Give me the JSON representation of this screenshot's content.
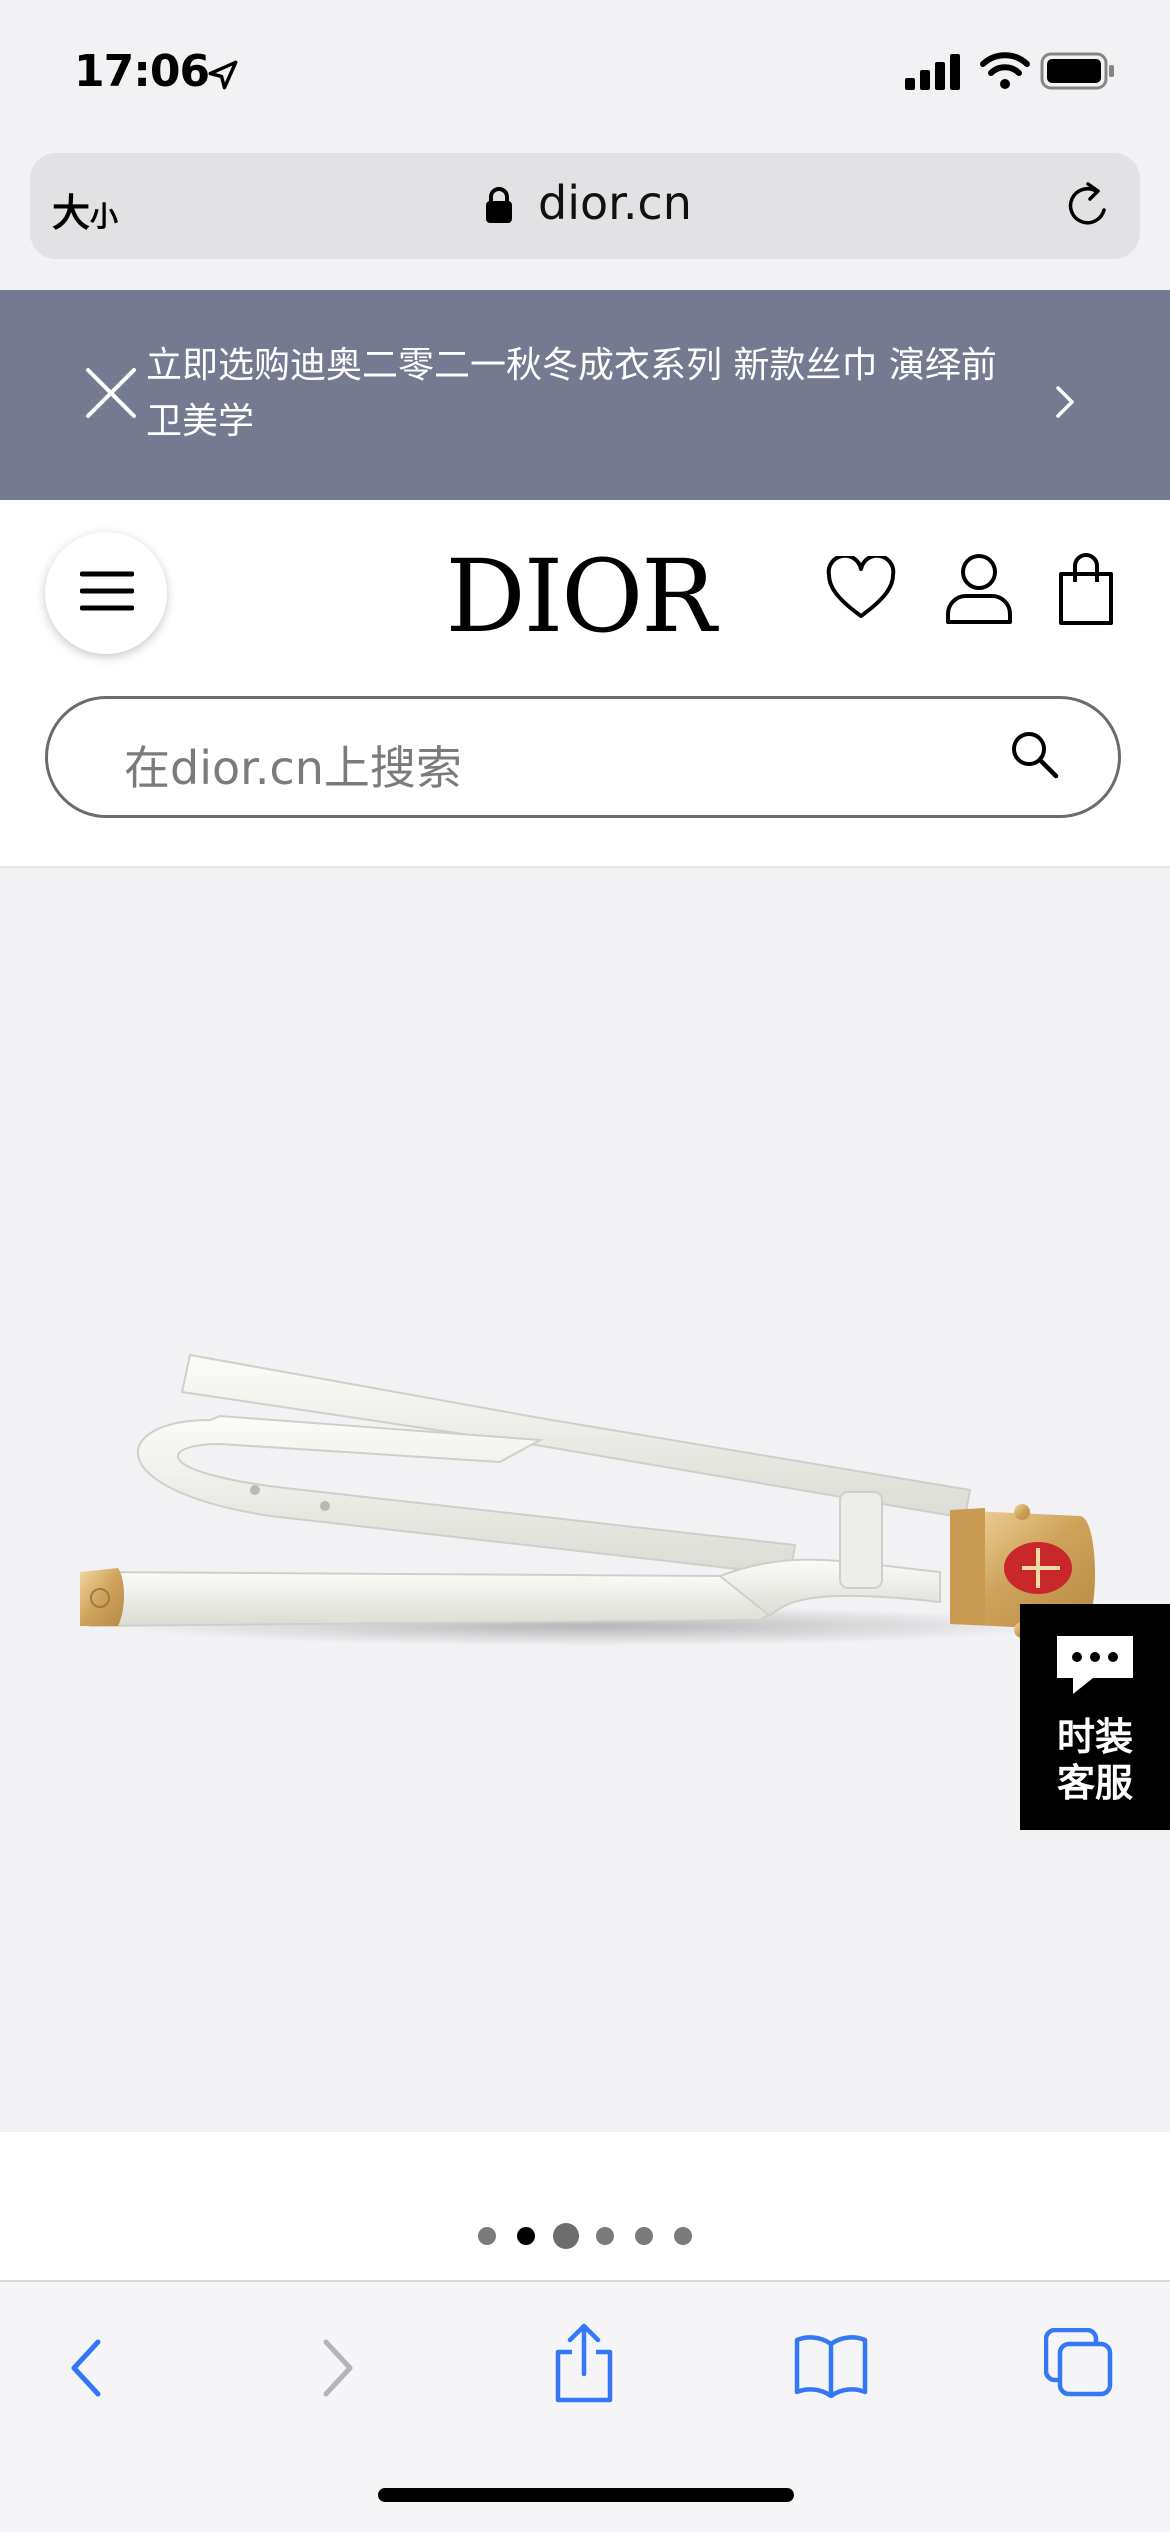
{
  "status_bar": {
    "time": "17:06"
  },
  "url_bar": {
    "text_size_big": "大",
    "text_size_small": "小",
    "url": "dior.cn"
  },
  "promo": {
    "text": "立即选购迪奥二零二一秋冬成衣系列 新款丝巾 演绎前卫美学"
  },
  "header": {
    "logo": "DIOR",
    "search_placeholder": "在dior.cn上搜索"
  },
  "product": {
    "image_icon": "belt-image",
    "carousel": {
      "total": 6,
      "active": 2
    }
  },
  "chat": {
    "label_line1": "时装",
    "label_line2": "客服"
  },
  "colors": {
    "promo_bg": "#767a91",
    "accent_blue": "#3478f6",
    "buckle_red": "#c8282a"
  }
}
